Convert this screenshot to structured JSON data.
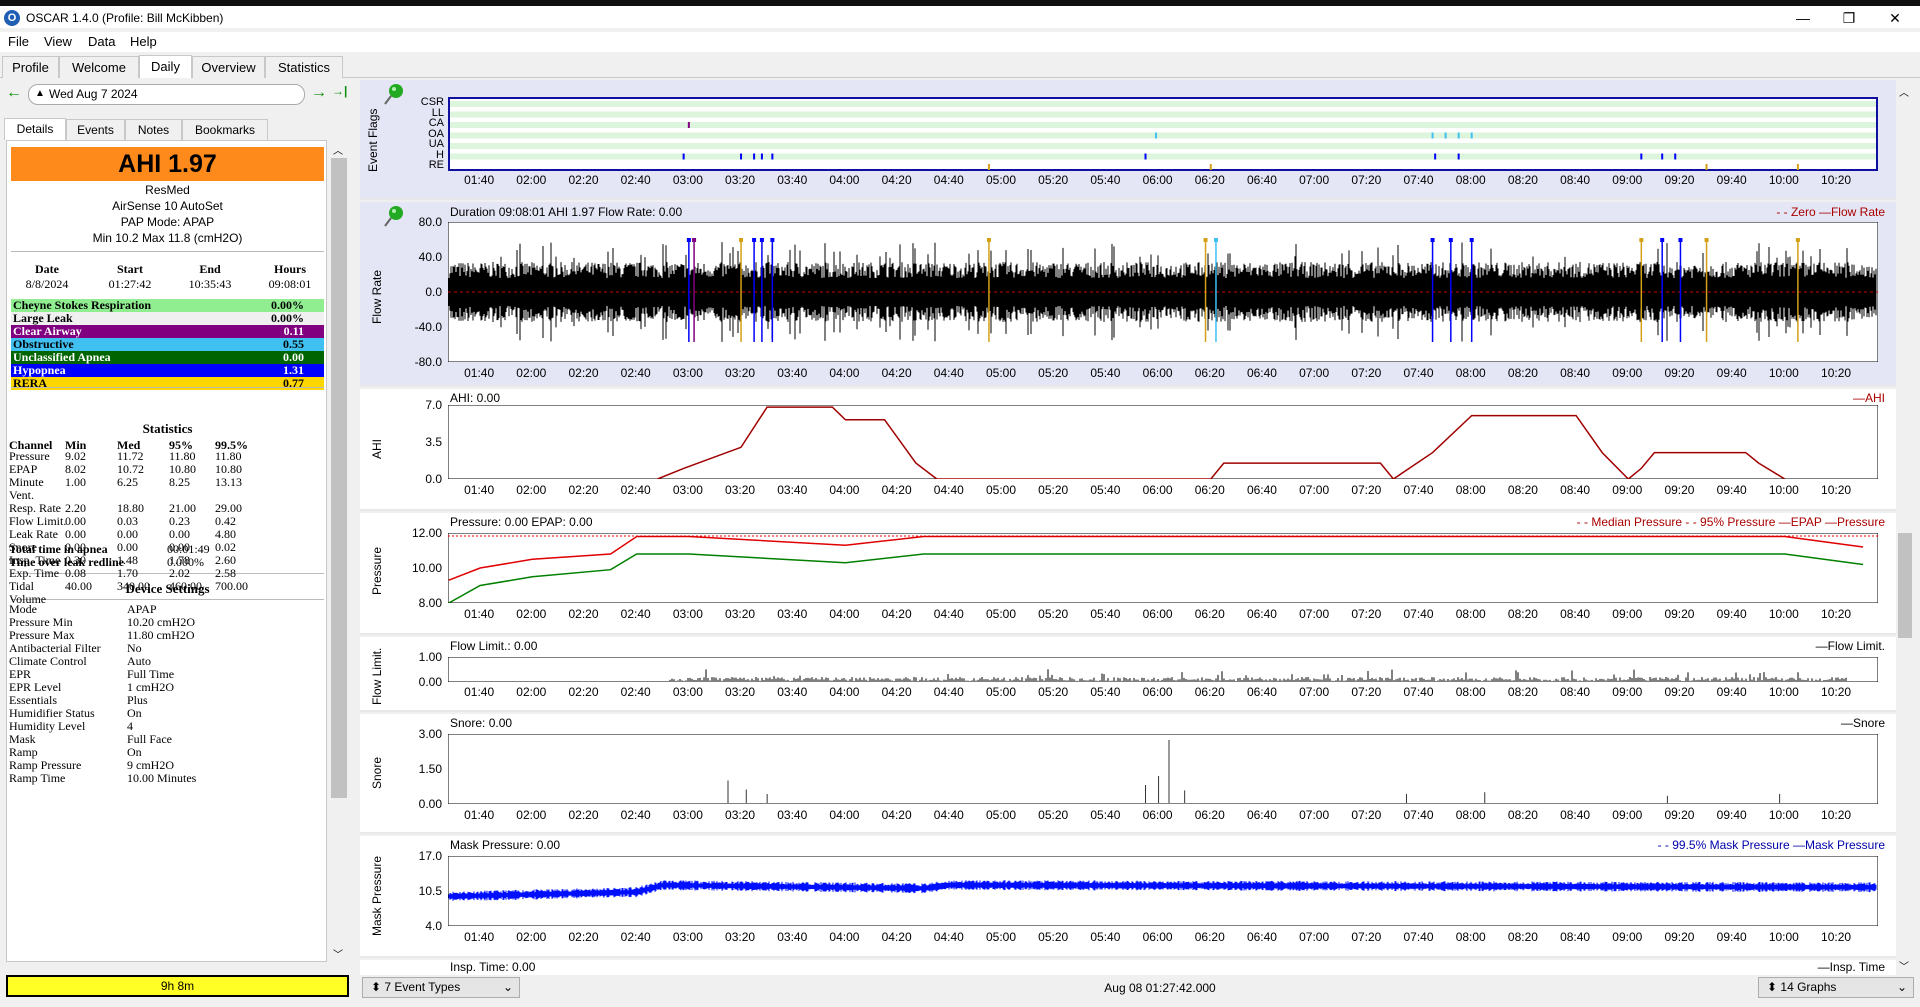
{
  "window": {
    "title": "OSCAR 1.4.0 (Profile: Bill McKibben)",
    "minimize": "—",
    "maximize": "❐",
    "close": "✕"
  },
  "menu": [
    "File",
    "View",
    "Data",
    "Help"
  ],
  "tabs": [
    "Profile",
    "Welcome",
    "Daily",
    "Overview",
    "Statistics"
  ],
  "active_tab": "Daily",
  "date_nav": {
    "date": "Wed Aug 7 2024",
    "prev": "←",
    "next": "→",
    "last": "→|"
  },
  "subtabs": [
    "Details",
    "Events",
    "Notes",
    "Bookmarks"
  ],
  "summary": {
    "ahi": "AHI 1.97",
    "device_brand": "ResMed",
    "device_model": "AirSense 10 AutoSet",
    "pap_mode": "PAP Mode: APAP",
    "pressure_range": "Min 10.2 Max 11.8 (cmH2O)"
  },
  "session": {
    "headers": [
      "Date",
      "Start",
      "End",
      "Hours"
    ],
    "values": [
      "8/8/2024",
      "01:27:42",
      "10:35:43",
      "09:08:01"
    ]
  },
  "events": [
    {
      "label": "Cheyne Stokes Respiration",
      "value": "0.00%",
      "color": "#90ee90",
      "text": "#000"
    },
    {
      "label": "Large Leak",
      "value": "0.00%",
      "color": "#f0f0f0",
      "text": "#000"
    },
    {
      "label": "Clear Airway",
      "value": "0.11",
      "color": "#800080",
      "text": "#fff"
    },
    {
      "label": "Obstructive",
      "value": "0.55",
      "color": "#40c0f0",
      "text": "#000"
    },
    {
      "label": "Unclassified Apnea",
      "value": "0.00",
      "color": "#006400",
      "text": "#fff"
    },
    {
      "label": "Hypopnea",
      "value": "1.31",
      "color": "#0000ff",
      "text": "#fff"
    },
    {
      "label": "RERA",
      "value": "0.77",
      "color": "#ffd700",
      "text": "#000"
    }
  ],
  "statistics": {
    "title": "Statistics",
    "headers": [
      "Channel",
      "Min",
      "Med",
      "95%",
      "99.5%"
    ],
    "rows": [
      [
        "Pressure",
        "9.02",
        "11.72",
        "11.80",
        "11.80"
      ],
      [
        "EPAP",
        "8.02",
        "10.72",
        "10.80",
        "10.80"
      ],
      [
        "Minute",
        "1.00",
        "6.25",
        "8.25",
        "13.13"
      ],
      [
        "Vent.",
        "",
        "",
        "",
        ""
      ],
      [
        "Resp. Rate",
        "2.20",
        "18.80",
        "21.00",
        "29.00"
      ],
      [
        "Flow Limit.",
        "0.00",
        "0.03",
        "0.23",
        "0.42"
      ],
      [
        "Leak Rate",
        "0.00",
        "0.00",
        "0.00",
        "4.80"
      ],
      [
        "Snore",
        "0.00",
        "0.00",
        "0.00",
        "0.02"
      ],
      [
        "Insp. Time",
        "0.30",
        "1.48",
        "1.78",
        "2.60"
      ],
      [
        "Exp. Time",
        "0.08",
        "1.70",
        "2.02",
        "2.58"
      ],
      [
        "Tidal",
        "40.00",
        "340.00",
        "460.00",
        "700.00"
      ],
      [
        "Volume",
        "",
        "",
        "",
        ""
      ]
    ]
  },
  "totals": [
    {
      "label": "Total time in apnea",
      "value": "00:01:49"
    },
    {
      "label": "Time over leak redline",
      "value": "0.000%"
    }
  ],
  "device_settings": {
    "title": "Device Settings",
    "rows": [
      [
        "Mode",
        "APAP"
      ],
      [
        "Pressure Min",
        "10.20 cmH2O"
      ],
      [
        "Pressure Max",
        "11.80 cmH2O"
      ],
      [
        "Antibacterial Filter",
        "No"
      ],
      [
        "Climate Control",
        "Auto"
      ],
      [
        "EPR",
        "Full Time"
      ],
      [
        "EPR Level",
        "1 cmH2O"
      ],
      [
        "Essentials",
        "Plus"
      ],
      [
        "Humidifier Status",
        "On"
      ],
      [
        "Humidity Level",
        "4"
      ],
      [
        "Mask",
        "Full Face"
      ],
      [
        "Ramp",
        "On"
      ],
      [
        "Ramp Pressure",
        "9 cmH2O"
      ],
      [
        "Ramp Time",
        "10.00 Minutes"
      ]
    ]
  },
  "status_bar": {
    "duration": "9h 8m"
  },
  "time_ticks": [
    "01:40",
    "02:00",
    "02:20",
    "02:40",
    "03:00",
    "03:20",
    "03:40",
    "04:00",
    "04:20",
    "04:40",
    "05:00",
    "05:20",
    "05:40",
    "06:00",
    "06:20",
    "06:40",
    "07:00",
    "07:20",
    "07:40",
    "08:00",
    "08:20",
    "08:40",
    "09:00",
    "09:20",
    "09:40",
    "10:00",
    "10:20"
  ],
  "graphs": {
    "event_flags": {
      "ylabel": "Event Flags",
      "rows": [
        "CSR",
        "LL",
        "CA",
        "OA",
        "UA",
        "H",
        "RE"
      ]
    },
    "flow_rate": {
      "ylabel": "Flow Rate",
      "title": "Duration 09:08:01 AHI 1.97 Flow Rate: 0.00",
      "legend": "- - Zero —Flow Rate",
      "yticks": [
        "80.0",
        "40.0",
        "0.0",
        "-40.0",
        "-80.0"
      ]
    },
    "ahi": {
      "ylabel": "AHI",
      "title": "AHI: 0.00",
      "legend": "—AHI",
      "yticks": [
        "7.0",
        "3.5",
        "0.0"
      ]
    },
    "pressure": {
      "ylabel": "Pressure",
      "title": "Pressure: 0.00 EPAP: 0.00",
      "legend": "- - Median Pressure - - 95% Pressure —EPAP —Pressure",
      "yticks": [
        "12.00",
        "10.00",
        "8.00"
      ]
    },
    "flow_limit": {
      "ylabel": "Flow Limit.",
      "title": "Flow Limit.: 0.00",
      "legend": "—Flow Limit.",
      "yticks": [
        "1.00",
        "0.00"
      ]
    },
    "snore": {
      "ylabel": "Snore",
      "title": "Snore: 0.00",
      "legend": "—Snore",
      "yticks": [
        "3.00",
        "1.50",
        "0.00"
      ]
    },
    "mask_pressure": {
      "ylabel": "Mask Pressure",
      "title": "Mask Pressure: 0.00",
      "legend": "- - 99.5% Mask Pressure —Mask Pressure",
      "yticks": [
        "17.0",
        "10.5",
        "4.0"
      ]
    },
    "insp_time": {
      "title": "Insp. Time: 0.00",
      "legend": "—Insp. Time"
    }
  },
  "chart_data": [
    {
      "type": "line",
      "title": "AHI",
      "x": [
        "02:48",
        "02:58",
        "03:20",
        "03:30",
        "03:55",
        "04:00",
        "04:15",
        "04:27",
        "04:35",
        "06:20",
        "06:25",
        "07:25",
        "07:30",
        "07:45",
        "08:00",
        "08:40",
        "08:50",
        "09:00",
        "09:05",
        "09:10",
        "09:45",
        "09:50",
        "10:00"
      ],
      "y": [
        0.0,
        1.0,
        3.0,
        6.8,
        6.8,
        5.6,
        5.6,
        1.5,
        0.0,
        0.0,
        1.5,
        1.5,
        0.0,
        2.5,
        6.0,
        6.0,
        2.5,
        0.0,
        1.0,
        2.5,
        2.5,
        1.5,
        0.0
      ],
      "ylim": [
        0,
        7.0
      ]
    },
    {
      "type": "line",
      "title": "Pressure",
      "series": [
        {
          "name": "Pressure",
          "x": [
            "01:28",
            "01:40",
            "02:00",
            "02:30",
            "02:40",
            "03:00",
            "04:00",
            "04:30",
            "05:00",
            "06:00",
            "07:00",
            "08:00",
            "09:00",
            "10:00",
            "10:30"
          ],
          "y": [
            9.3,
            10.0,
            10.5,
            10.8,
            11.8,
            11.8,
            11.3,
            11.8,
            11.8,
            11.8,
            11.8,
            11.8,
            11.8,
            11.8,
            11.2
          ]
        },
        {
          "name": "EPAP",
          "x": [
            "01:28",
            "01:40",
            "02:00",
            "02:30",
            "02:40",
            "03:00",
            "04:00",
            "04:30",
            "05:00",
            "06:00",
            "07:00",
            "08:00",
            "09:00",
            "10:00",
            "10:30"
          ],
          "y": [
            8.0,
            9.0,
            9.5,
            9.9,
            10.8,
            10.8,
            10.3,
            10.8,
            10.8,
            10.8,
            10.8,
            10.8,
            10.8,
            10.8,
            10.2
          ]
        }
      ],
      "ylim": [
        8.0,
        12.0
      ]
    },
    {
      "type": "line",
      "title": "Mask Pressure",
      "x": [
        "01:28",
        "02:40",
        "02:50",
        "04:30",
        "04:40",
        "10:35"
      ],
      "y": [
        9.5,
        10.3,
        11.6,
        11.0,
        11.6,
        11.2
      ],
      "ylim": [
        4.0,
        17.0
      ]
    }
  ]
}
